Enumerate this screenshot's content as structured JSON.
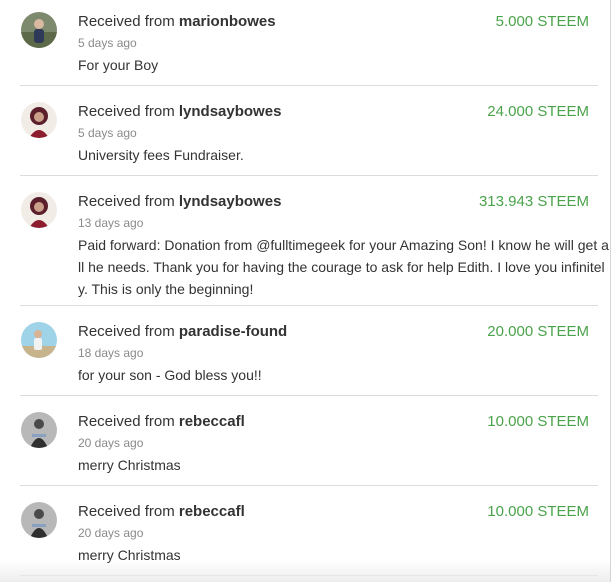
{
  "accent_color": "#4ba34b",
  "transfers": [
    {
      "prefix": "Received from",
      "from": "marionbowes",
      "time": "5 days ago",
      "amount": "5.000 STEEM",
      "memo_lines": [
        "For your Boy"
      ],
      "avatar_icon": "user-avatar-icon"
    },
    {
      "prefix": "Received from",
      "from": "lyndsaybowes",
      "time": "5 days ago",
      "amount": "24.000 STEEM",
      "memo_lines": [
        "University fees Fundraiser."
      ],
      "avatar_icon": "user-avatar-icon"
    },
    {
      "prefix": "Received from",
      "from": "lyndsaybowes",
      "time": "13 days ago",
      "amount": "313.943 STEEM",
      "memo_lines": [
        "Paid forward: Donation from @fulltimegeek for your Amazing Son! I know he will get a",
        "ll he needs. Thank you for having the courage to ask for help Edith. I love you infinitel",
        "y. This is only the beginning!"
      ],
      "avatar_icon": "user-avatar-icon"
    },
    {
      "prefix": "Received from",
      "from": "paradise-found",
      "time": "18 days ago",
      "amount": "20.000 STEEM",
      "memo_lines": [
        "for your son - God bless you!!"
      ],
      "avatar_icon": "user-avatar-icon"
    },
    {
      "prefix": "Received from",
      "from": "rebeccafl",
      "time": "20 days ago",
      "amount": "10.000 STEEM",
      "memo_lines": [
        "merry Christmas"
      ],
      "avatar_icon": "user-avatar-icon"
    },
    {
      "prefix": "Received from",
      "from": "rebeccafl",
      "time": "20 days ago",
      "amount": "10.000 STEEM",
      "memo_lines": [
        "merry Christmas"
      ],
      "avatar_icon": "user-avatar-icon"
    }
  ]
}
